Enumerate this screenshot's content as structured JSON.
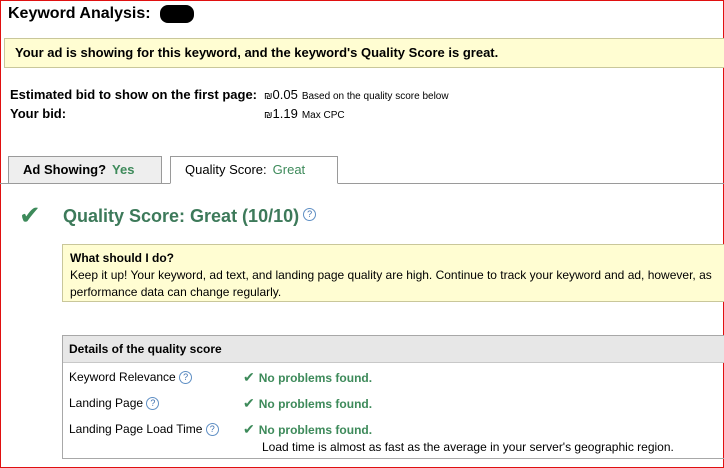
{
  "header": {
    "title": "Keyword Analysis:"
  },
  "notice": {
    "text": "Your ad is showing for this keyword, and the keyword's Quality Score is great."
  },
  "bids": {
    "first_page_label": "Estimated bid to show on the first page:",
    "first_page_currency": "₪",
    "first_page_value": "0.05",
    "first_page_note": "Based on the quality score below",
    "your_bid_label": "Your bid:",
    "your_bid_currency": "₪",
    "your_bid_value": "1.19",
    "your_bid_note": "Max CPC"
  },
  "tabs": [
    {
      "label": "Ad Showing?",
      "value": "Yes"
    },
    {
      "label": "Quality Score:",
      "value": "Great"
    }
  ],
  "quality": {
    "heading": "Quality Score: Great (10/10)",
    "help": "?",
    "colors": {
      "accent_green": "#3d8a5a",
      "notice_bg": "#fffdd2"
    }
  },
  "advice": {
    "heading": "What should I do?",
    "body": "Keep it up! Your keyword, ad text, and landing page quality are high. Continue to track your keyword and ad, however, as performance data can change regularly."
  },
  "details": {
    "heading": "Details of the quality score",
    "rows": [
      {
        "label": "Keyword Relevance",
        "status": "No problems found.",
        "note": ""
      },
      {
        "label": "Landing Page",
        "status": "No problems found.",
        "note": ""
      },
      {
        "label": "Landing Page Load Time",
        "status": "No problems found.",
        "note": "Load time is almost as fast as the average in your server's geographic region."
      }
    ]
  }
}
